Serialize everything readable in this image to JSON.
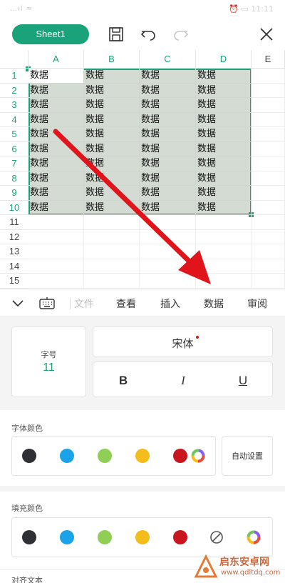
{
  "status_bar": {
    "left": "…ıl ≈",
    "right": "⏰ ▭ 11:11"
  },
  "toolbar": {
    "sheet_tab": "Sheet1",
    "icons": [
      "save-icon",
      "undo-icon",
      "redo-icon",
      "close-icon"
    ]
  },
  "sheet": {
    "columns": [
      "A",
      "B",
      "C",
      "D",
      "E"
    ],
    "rows": [
      "1",
      "2",
      "3",
      "4",
      "5",
      "6",
      "7",
      "8",
      "9",
      "10",
      "11",
      "12",
      "13",
      "14",
      "15"
    ],
    "cell_text": "数据",
    "filled_rows": 10,
    "filled_cols": 4
  },
  "menubar": {
    "tabs": [
      "文件",
      "查看",
      "插入",
      "数据",
      "审阅"
    ]
  },
  "font_panel": {
    "size_label": "字号",
    "size_value": "11",
    "font_name": "宋体",
    "bold": "B",
    "italic": "I",
    "underline": "U"
  },
  "font_color": {
    "title": "字体颜色",
    "swatches": [
      "#2f3035",
      "#1aa3e8",
      "#8fcf56",
      "#f4bd1b",
      "#c9151e"
    ],
    "auto_label": "自动设置"
  },
  "fill_color": {
    "title": "填充颜色",
    "swatches": [
      "#2f3035",
      "#1aa3e8",
      "#8fcf56",
      "#f4bd1b",
      "#c9151e"
    ]
  },
  "align": {
    "title": "对齐文本"
  },
  "watermark": {
    "name": "启东安卓网",
    "url": "www.qdltdq.com"
  },
  "colors": {
    "accent": "#1aa37a",
    "selection": "#d4dbd3"
  }
}
